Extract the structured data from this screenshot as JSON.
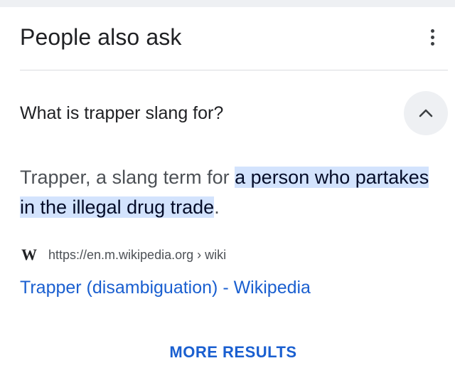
{
  "section": {
    "title": "People also ask",
    "menu_icon": "more-vert-icon"
  },
  "question": {
    "text": "What is trapper slang for?",
    "expanded": true,
    "toggle_icon": "chevron-up-icon"
  },
  "answer": {
    "prefix": "Trapper, a slang term for ",
    "highlight": "a person who partakes in the illegal drug trade",
    "suffix": "."
  },
  "source": {
    "icon": "wikipedia-w-icon",
    "icon_text": "W",
    "url": "https://en.m.wikipedia.org › wiki",
    "link_title": "Trapper (disambiguation) - Wikipedia"
  },
  "footer": {
    "more_results": "MORE RESULTS"
  },
  "colors": {
    "highlight_bg": "#d3e3fd",
    "link": "#1a5fd0",
    "text_primary": "#202124",
    "text_secondary": "#4d5156"
  }
}
